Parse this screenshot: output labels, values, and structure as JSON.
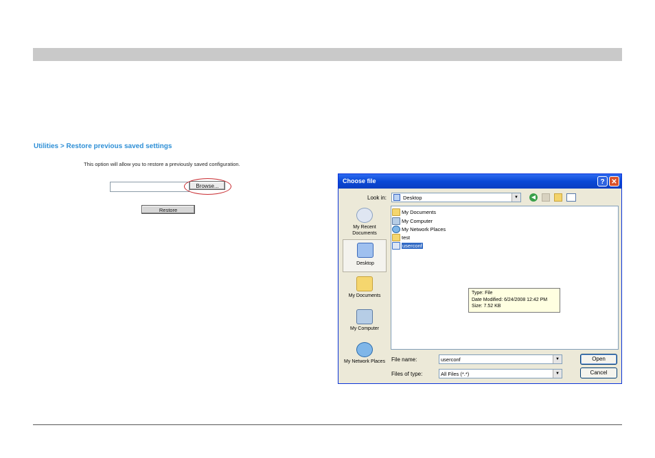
{
  "page": {
    "breadcrumb": "Utilities > Restore previous saved settings",
    "description": "This option will allow you to restore a previously saved configuration.",
    "browse_label": "Browse...",
    "restore_label": "Restore"
  },
  "dialog": {
    "title": "Choose file",
    "help_label": "?",
    "close_label": "✕",
    "look_in_label": "Look in:",
    "look_in_value": "Desktop",
    "icons": {
      "back": "back-arrow-icon",
      "up": "up-folder-icon",
      "new_folder": "new-folder-icon",
      "views": "views-menu-icon"
    },
    "places": [
      {
        "label": "My Recent Documents",
        "icon": "recent-documents-icon"
      },
      {
        "label": "Desktop",
        "icon": "desktop-icon"
      },
      {
        "label": "My Documents",
        "icon": "my-documents-icon"
      },
      {
        "label": "My Computer",
        "icon": "my-computer-icon"
      },
      {
        "label": "My Network Places",
        "icon": "network-places-icon"
      }
    ],
    "files": [
      {
        "name": "My Documents",
        "icon": "documents-folder-icon"
      },
      {
        "name": "My Computer",
        "icon": "computer-icon"
      },
      {
        "name": "My Network Places",
        "icon": "network-icon"
      },
      {
        "name": "test",
        "icon": "folder-icon"
      },
      {
        "name": "userconf",
        "icon": "file-icon"
      }
    ],
    "tooltip": {
      "type": "Type: File",
      "date": "Date Modified: 6/24/2008 12:42 PM",
      "size": "Size: 7.52 KB"
    },
    "file_name_label": "File name:",
    "file_name_value": "userconf",
    "files_of_type_label": "Files of type:",
    "files_of_type_value": "All Files (*.*)",
    "open_label": "Open",
    "cancel_label": "Cancel"
  },
  "colors": {
    "accent": "#2e8fd6",
    "title_bar": "#0a49d6",
    "highlight": "#c8282d",
    "selection": "#316ac5"
  }
}
